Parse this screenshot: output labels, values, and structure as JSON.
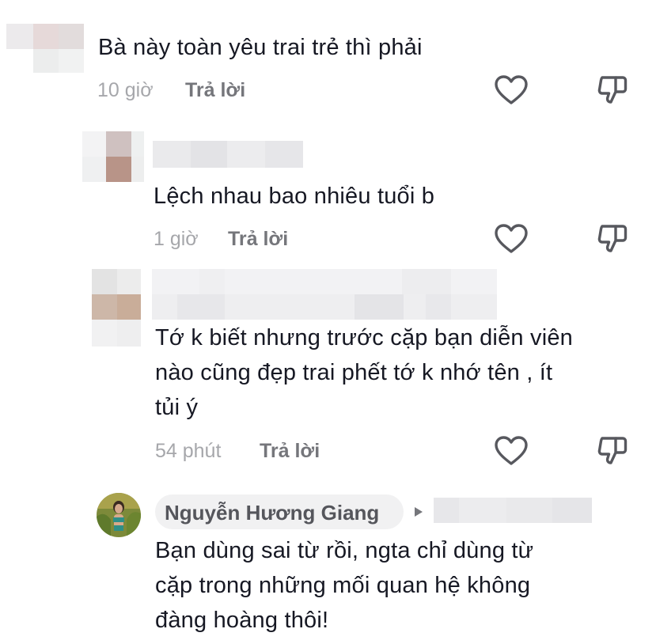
{
  "comments": [
    {
      "text": "Bà này toàn yêu trai trẻ thì phải",
      "time": "10 giờ",
      "reply_label": "Trả lời"
    },
    {
      "text": "Lệch nhau bao nhiêu tuổi b",
      "time": "1 giờ",
      "reply_label": "Trả lời"
    },
    {
      "text_lines": [
        "Tớ k biết nhưng trước cặp bạn diễn viên",
        "nào cũng đẹp trai phết tớ k nhớ tên , ít",
        "tủi ý"
      ],
      "time": "54 phút",
      "reply_label": "Trả lời"
    },
    {
      "username": "Nguyễn Hương Giang",
      "text_lines": [
        "Bạn dùng sai từ rồi, ngta chỉ dùng từ",
        "cặp trong những mối quan hệ không",
        "đàng hoàng thôi!"
      ]
    }
  ],
  "icons": {
    "like": "heart-icon",
    "dislike": "thumbs-down-icon",
    "arrow": "caret-right-icon"
  },
  "colors": {
    "text": "#161823",
    "muted": "#a6a7ab",
    "reply": "#75767b"
  }
}
